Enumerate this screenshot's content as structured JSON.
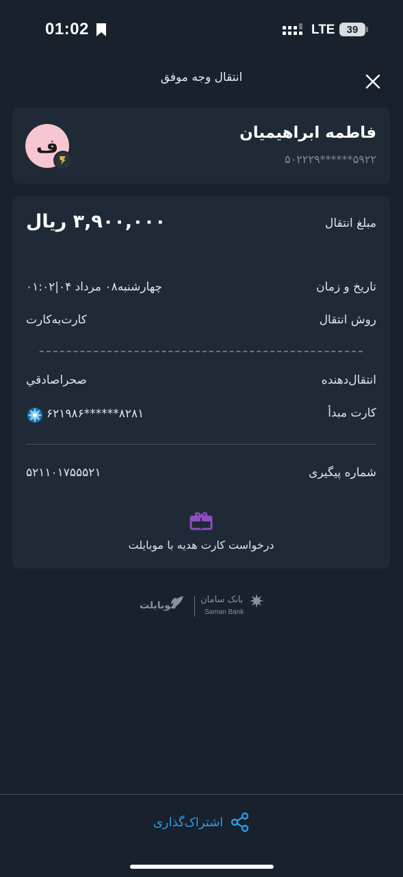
{
  "status_bar": {
    "time": "01:02",
    "network": "LTE",
    "battery": "39"
  },
  "header": {
    "title": "انتقال وجه موفق",
    "close_icon": "close-icon"
  },
  "recipient": {
    "name": "فاطمه ابراهیمیان",
    "card_number": "۵۰۲۲۲۹******۵۹۲۲",
    "avatar_letter": "ف",
    "avatar_color": "#f7c7d1"
  },
  "details": {
    "amount_label": "مبلغ انتقال",
    "amount_value": "۳,۹۰۰,۰۰۰ ریال",
    "datetime_label": "تاریخ و زمان",
    "datetime_value": "چهارشنبه۰۸ مرداد ۰۴|۰۱:۰۲",
    "method_label": "روش انتقال",
    "method_value": "کارت‌به‌کارت",
    "sender_label": "انتقال‌دهنده",
    "sender_value": "صحراصادقي",
    "source_card_label": "کارت مبدأ",
    "source_card_value": "۶۲۱۹۸۶******۸۲۸۱",
    "tracking_label": "شماره پیگیری",
    "tracking_value": "۵۲۱۱۰۱۷۵۵۵۲۱"
  },
  "gift": {
    "label": "درخواست کارت هدیه با موبایلت",
    "icon": "gift-icon",
    "icon_color": "#8e4fc2"
  },
  "footer_logos": {
    "mobile_brand": "موبایلت",
    "bank_brand_fa": "بانک سامان",
    "bank_brand_en": "Saman Bank"
  },
  "bottom": {
    "share_label": "اشتراک‌گذاری",
    "share_icon": "share-icon",
    "accent": "#2f9be9"
  }
}
